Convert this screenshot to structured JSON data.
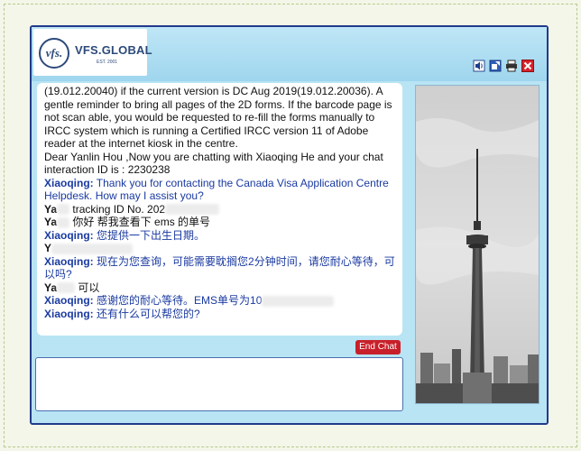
{
  "brand": {
    "logo_mark": "vfs.",
    "name": "VFS.GLOBAL",
    "est": "EST. 2001"
  },
  "toolbar_icons": [
    "speaker-icon",
    "popout-icon",
    "print-icon",
    "close-icon"
  ],
  "chat": {
    "lines": [
      {
        "type": "text",
        "text": "(19.012.20040) if the current version is DC Aug 2019(19.012.20036). A gentle reminder to bring all pages of the 2D forms. If the barcode page is not scan able, you would be requested to re-fill the forms manually to IRCC system which is running a Certified IRCC version 11 of Adobe reader at the internet kiosk in the centre."
      },
      {
        "type": "text",
        "text": "Dear Yanlin Hou ,Now you are chatting with Xiaoqing He and your chat interaction ID is : 2230238"
      },
      {
        "type": "agent",
        "name": "Xiaoqing:",
        "text": "Thank you for contacting the Canada Visa Application Centre Helpdesk. How may I assist you?"
      },
      {
        "type": "user",
        "name": "Ya",
        "text": "tracking ID No. 202"
      },
      {
        "type": "user",
        "name": "Ya",
        "text": "你好 帮我查看下 ems 的单号"
      },
      {
        "type": "agent",
        "name": "Xiaoqing:",
        "text": "您提供一下出生日期。"
      },
      {
        "type": "user",
        "name": "Y",
        "text": ""
      },
      {
        "type": "agent",
        "name": "Xiaoqing:",
        "text": "现在为您查询，可能需要耽搁您2分钟时间，请您耐心等待，可以吗?"
      },
      {
        "type": "user",
        "name": "Ya",
        "text": "可以"
      },
      {
        "type": "agent",
        "name": "Xiaoqing:",
        "text": "感谢您的耐心等待。EMS单号为10"
      },
      {
        "type": "agent",
        "name": "Xiaoqing:",
        "text": "还有什么可以帮您的?"
      }
    ]
  },
  "end_chat_label": "End Chat",
  "input": {
    "value": "",
    "placeholder": ""
  },
  "colors": {
    "window_bg": "#b8e4f4",
    "border": "#223a8a",
    "agent": "#1a3aa0",
    "end_button": "#c8202a"
  }
}
